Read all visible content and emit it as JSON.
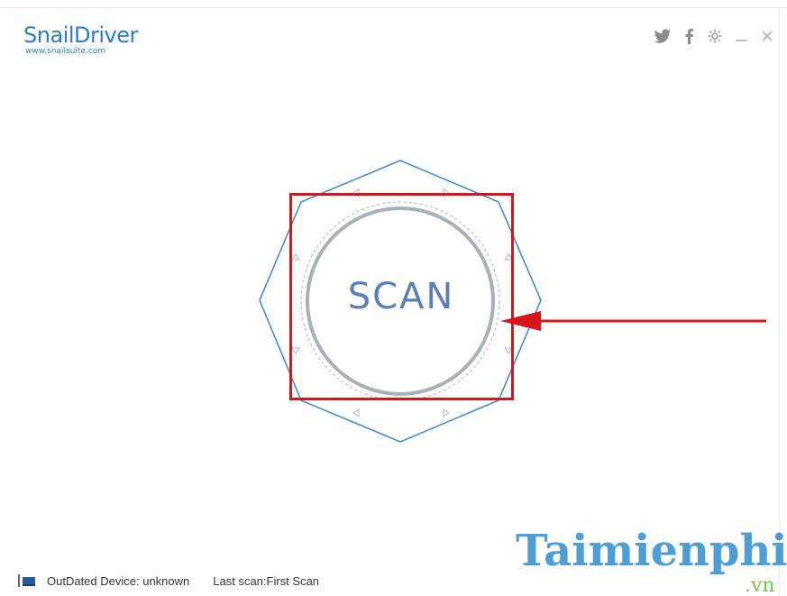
{
  "app": {
    "title": "SnailDriver",
    "url": "www.snailsuite.com"
  },
  "titlebar": {
    "controls": [
      {
        "name": "twitter-icon"
      },
      {
        "name": "facebook-icon"
      },
      {
        "name": "settings-icon"
      },
      {
        "name": "minimize-icon"
      },
      {
        "name": "close-icon"
      }
    ]
  },
  "main": {
    "scan_label": "SCAN"
  },
  "status": {
    "outdated_label": "OutDated Device: unknown",
    "last_scan_label": "Last scan:First Scan"
  },
  "watermark": {
    "text": "Taimienphi",
    "tld": ".vn"
  },
  "colors": {
    "brand": "#2b7cc8",
    "scan_text": "#5a7fb8",
    "hex_stroke": "#3f8fd6",
    "ring": "#a9b1b6",
    "annotation": "#d8141c",
    "watermark": "#2e8ecf",
    "watermark_tld": "#7cc34a"
  }
}
